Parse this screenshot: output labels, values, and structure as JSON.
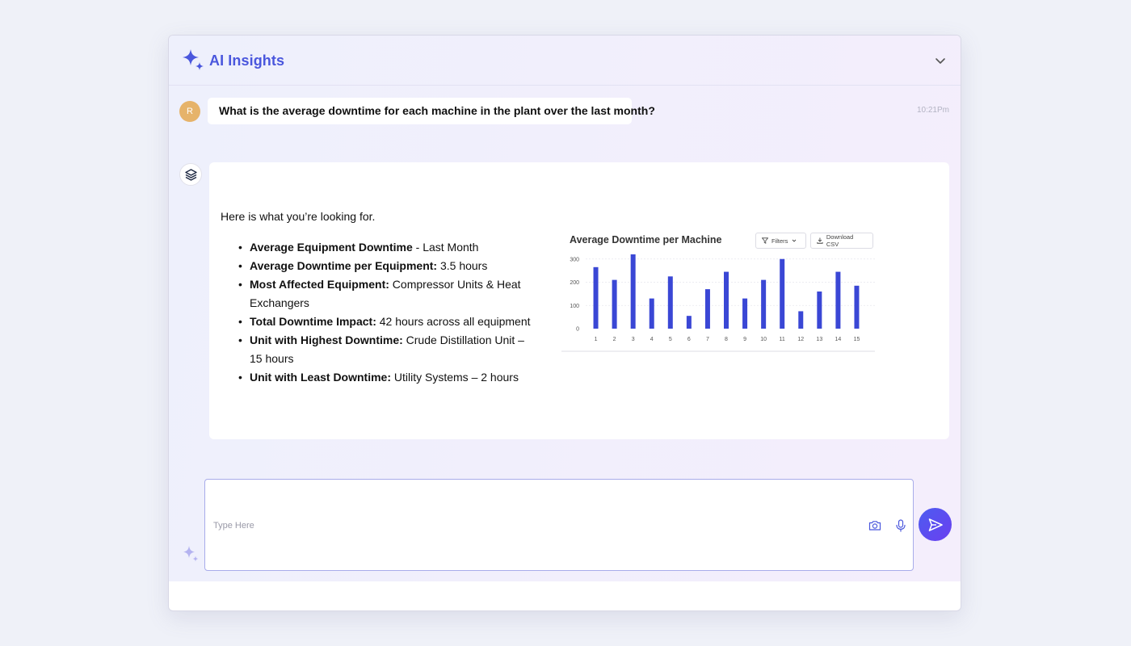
{
  "header": {
    "title": "AI Insights",
    "brand_icon": "sparkle-icon",
    "collapse_icon": "chevron-down-icon"
  },
  "user_message": {
    "avatar_initial": "R",
    "text": "What is the average downtime for each machine in the plant over the last month?",
    "time": "10:21Pm"
  },
  "bot_message": {
    "intro": "Here is what you’re looking for.",
    "bullets": [
      {
        "label": "Average Equipment Downtime",
        "value": " - Last Month"
      },
      {
        "label": "Average Downtime per Equipment:",
        "value": " 3.5 hours"
      },
      {
        "label": "Most Affected Equipment:",
        "value": " Compressor Units & Heat Exchangers"
      },
      {
        "label": "Total Downtime Impact:",
        "value": " 42 hours across all equipment"
      },
      {
        "label": "Unit with Highest Downtime:",
        "value": " Crude Distillation Unit – 15 hours"
      },
      {
        "label": "Unit with Least Downtime:",
        "value": " Utility Systems – 2 hours"
      }
    ],
    "filters_label": "Filters",
    "download_label": "Download CSV"
  },
  "chart_data": {
    "type": "bar",
    "title": "Average Downtime per Machine",
    "categories": [
      "1",
      "2",
      "3",
      "4",
      "5",
      "6",
      "7",
      "8",
      "9",
      "10",
      "11",
      "12",
      "13",
      "14",
      "15"
    ],
    "values": [
      265,
      210,
      320,
      130,
      225,
      55,
      170,
      245,
      130,
      210,
      300,
      75,
      160,
      245,
      185
    ],
    "yticks": [
      0,
      100,
      200,
      300
    ],
    "ylim": [
      0,
      320
    ],
    "grid": true,
    "color": "#3a47d5"
  },
  "composer": {
    "placeholder": "Type Here"
  },
  "colors": {
    "accent": "#4a57dd",
    "bar": "#3a47d5",
    "send": "#5b4ff0"
  }
}
